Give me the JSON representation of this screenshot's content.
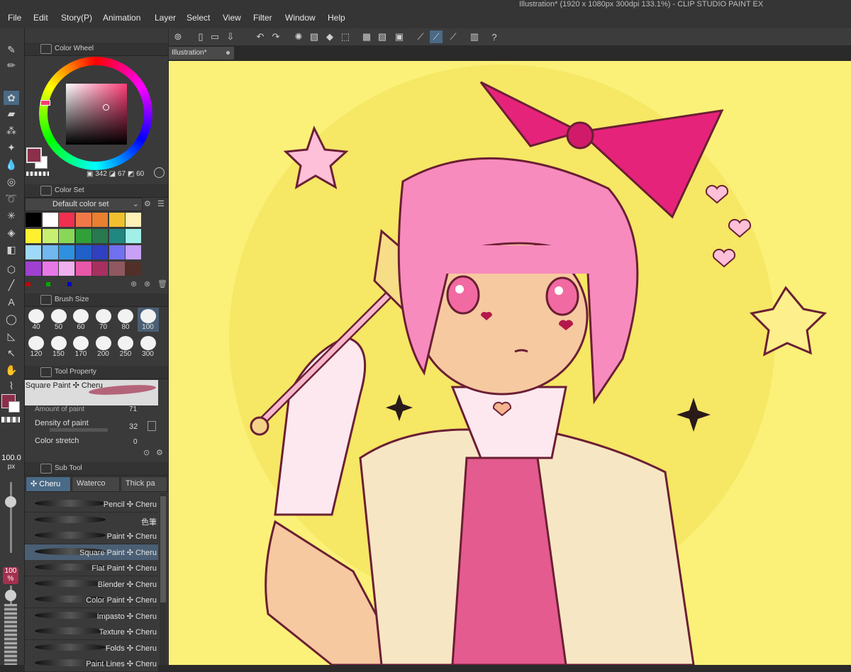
{
  "app": {
    "title": "Illustration* (1920 x 1080px 300dpi 133.1%)  - CLIP STUDIO PAINT EX"
  },
  "menu": [
    "File",
    "Edit",
    "Story(P)",
    "Animation",
    "Layer",
    "Select",
    "View",
    "Filter",
    "Window",
    "Help"
  ],
  "color_wheel": {
    "title": "Color Wheel",
    "h": "342",
    "s": "67",
    "v": "60",
    "main_color": "#8c2f4a"
  },
  "color_set": {
    "title": "Color Set",
    "preset": "Default color set",
    "swatches": [
      "#000000",
      "#ffffff",
      "#f03050",
      "#f07848",
      "#e88030",
      "#f0c030",
      "#fff0b8",
      "#fff030",
      "#c8f070",
      "#88d858",
      "#30a038",
      "#287850",
      "#208880",
      "#a0f0e8",
      "#a0d8f8",
      "#70b8f0",
      "#3090e0",
      "#2060c8",
      "#3040c0",
      "#7070f0",
      "#c8a0f8",
      "#a040d0",
      "#e878e8",
      "#f0b0f0",
      "#e858a8",
      "#a83060",
      "#905860",
      "#503028"
    ]
  },
  "brush_size": {
    "title": "Brush Size",
    "sizes": [
      "40",
      "50",
      "60",
      "70",
      "80",
      "100",
      "120",
      "150",
      "170",
      "200",
      "250",
      "300"
    ],
    "selected": "100"
  },
  "tool_property": {
    "title": "Tool Property",
    "brush_name": "Square Paint ✣ Cheru",
    "rows": [
      {
        "label": "Amount of paint",
        "value": "71"
      },
      {
        "label": "Density of paint",
        "value": "32"
      },
      {
        "label": "Color stretch",
        "value": "0"
      }
    ]
  },
  "sub_tool": {
    "title": "Sub Tool",
    "tabs": [
      "✣ Cheru",
      "Waterco",
      "Thick pa"
    ],
    "brushes": [
      "Pencil ✣ Cheru",
      "色筆",
      "Paint ✣ Cheru",
      "Square Paint ✣ Cheru",
      "Flat Paint ✣ Cheru",
      "Blender ✣ Cheru",
      "Color Paint ✣ Cheru",
      "Impasto ✣ Cheru",
      "Texture ✣ Cheru",
      "Folds ✣ Cheru",
      "Paint Lines ✣ Cheru"
    ],
    "selected": "Square Paint ✣ Cheru"
  },
  "brush_indicator": {
    "size_value": "100.0",
    "size_unit": "px",
    "opacity_value": "100",
    "opacity_unit": "%"
  },
  "document_tab": {
    "label": "Illustration*"
  },
  "canvas": {
    "background": "#fbf178"
  }
}
